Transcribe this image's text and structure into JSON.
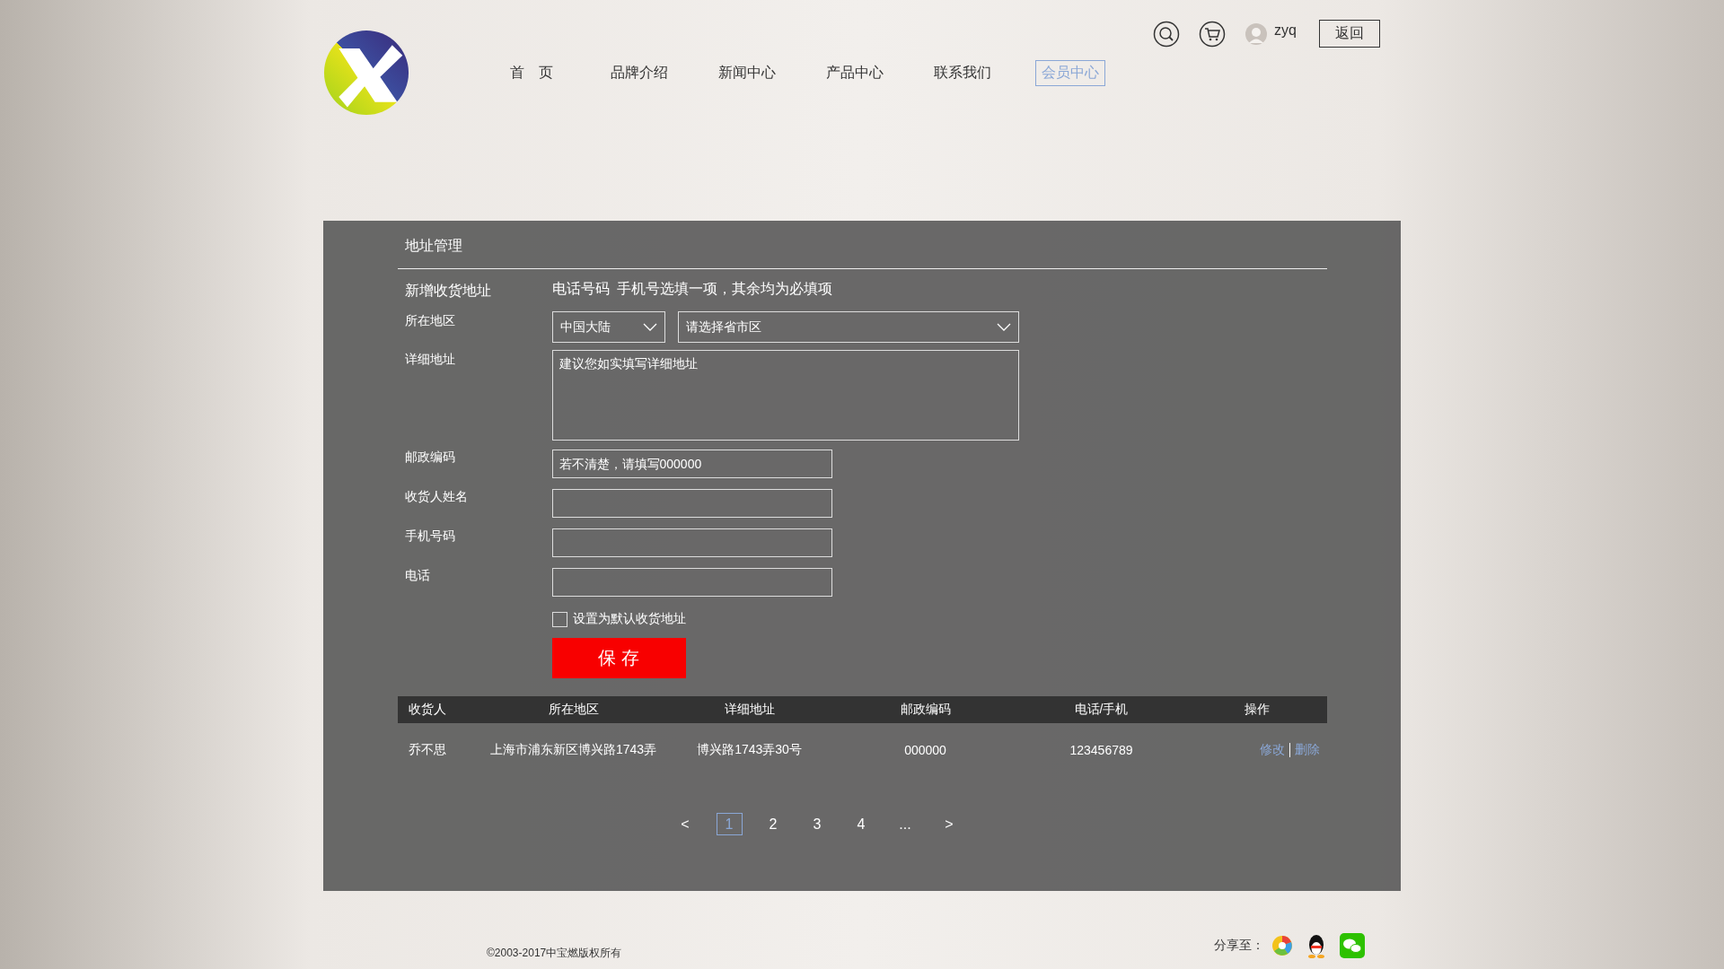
{
  "header": {
    "nav": [
      {
        "label": "首　页",
        "selected": false
      },
      {
        "label": "品牌介绍",
        "selected": false
      },
      {
        "label": "新闻中心",
        "selected": false
      },
      {
        "label": "产品中心",
        "selected": false
      },
      {
        "label": "联系我们",
        "selected": false
      },
      {
        "label": "会员中心",
        "selected": true
      }
    ],
    "user": {
      "name": "zyq"
    },
    "back_button": "返回"
  },
  "panel": {
    "title": "地址管理",
    "form_title": "新增收货地址",
    "note": "电话号码  手机号选填一项，其余均为必填项",
    "fields": [
      {
        "kind": "region",
        "label": "所在地区",
        "country": "中国大陆",
        "region_placeholder": "请选择省市区"
      },
      {
        "kind": "textarea",
        "label": "详细地址",
        "placeholder": "建议您如实填写详细地址"
      },
      {
        "kind": "input",
        "label": "邮政编码",
        "placeholder": "若不清楚，请填写000000"
      },
      {
        "kind": "input",
        "label": "收货人姓名"
      },
      {
        "kind": "input",
        "label": "手机号码"
      },
      {
        "kind": "input",
        "label": "电话"
      }
    ],
    "default_checkbox": {
      "label": "设置为默认收货地址",
      "checked": false
    },
    "save_button": "保 存"
  },
  "table": {
    "columns": [
      "收货人",
      "所在地区",
      "详细地址",
      "邮政编码",
      "电话/手机",
      "操作"
    ],
    "rows": [
      {
        "cells": [
          "乔不思",
          "上海市浦东新区博兴路1743弄",
          "博兴路1743弄30号",
          "000000",
          "123456789"
        ],
        "actions": [
          "修改",
          "删除"
        ]
      }
    ]
  },
  "pagination": [
    {
      "label": "<",
      "selected": false
    },
    {
      "label": "1",
      "selected": true
    },
    {
      "label": "2",
      "selected": false
    },
    {
      "label": "3",
      "selected": false
    },
    {
      "label": "4",
      "selected": false
    },
    {
      "label": "...",
      "selected": false
    },
    {
      "label": ">",
      "selected": false
    }
  ],
  "footer": {
    "copyright": "©2003-2017中宝燃版权所有",
    "share_label": "分享至："
  }
}
